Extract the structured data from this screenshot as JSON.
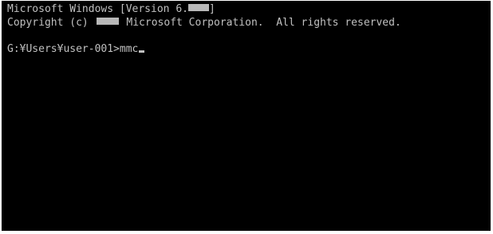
{
  "console": {
    "header_line_1_prefix": "Microsoft Windows [Version 6.",
    "header_line_1_suffix": "]",
    "header_line_2_prefix": "Copyright (c)",
    "header_line_2_suffix": "Microsoft Corporation.  All rights reserved.",
    "prompt": "G:¥Users¥user-001>",
    "command": "mmc"
  }
}
